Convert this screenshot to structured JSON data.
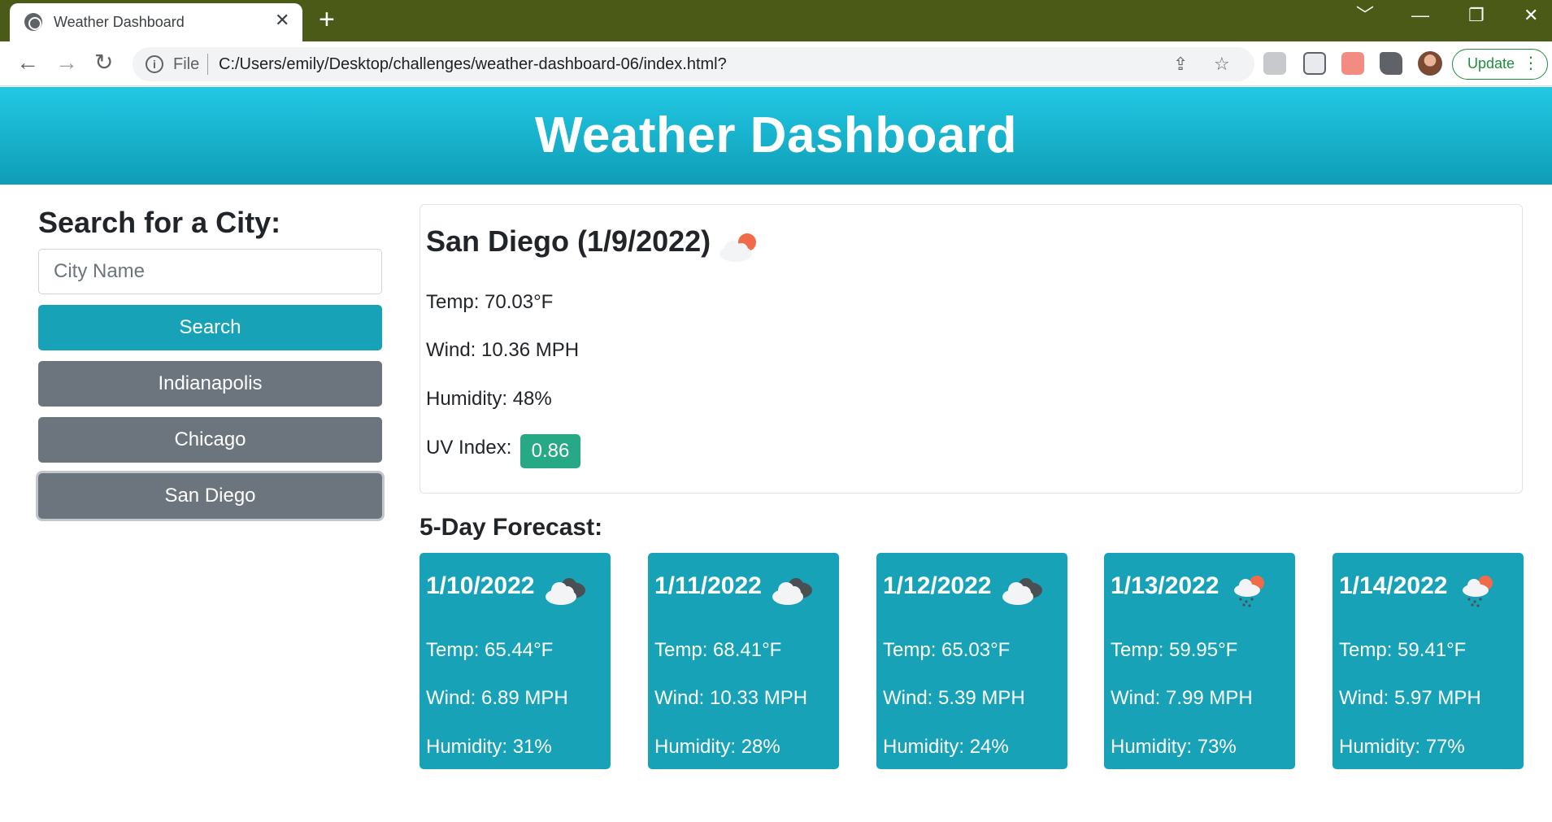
{
  "browser": {
    "tab_title": "Weather Dashboard",
    "tab_close": "✕",
    "new_tab": "+",
    "window_controls": [
      "﹀",
      "—",
      "❐",
      "✕"
    ],
    "nav": {
      "back": "←",
      "forward": "→",
      "reload": "↻"
    },
    "scheme": "File",
    "url": "C:/Users/emily/Desktop/challenges/weather-dashboard-06/index.html?",
    "update_label": "Update",
    "update_menu": "⋮"
  },
  "header": {
    "title": "Weather Dashboard"
  },
  "sidebar": {
    "heading": "Search for a City:",
    "search_placeholder": "City Name",
    "search_value": "",
    "search_button": "Search",
    "history": [
      "Indianapolis",
      "Chicago",
      "San Diego"
    ]
  },
  "current": {
    "title": "San Diego (1/9/2022)",
    "icon": "few-clouds-day-icon",
    "temp": "Temp: 70.03°F",
    "wind": "Wind: 10.36 MPH",
    "humidity": "Humidity: 48%",
    "uv_label": "UV Index:",
    "uv_value": "0.86",
    "uv_color": "#28a985"
  },
  "forecast": {
    "heading": "5-Day Forecast:",
    "days": [
      {
        "date": "1/10/2022",
        "icon": "broken-clouds-icon",
        "temp": "Temp: 65.44°F",
        "wind": "Wind: 6.89 MPH",
        "humidity": "Humidity: 31%"
      },
      {
        "date": "1/11/2022",
        "icon": "broken-clouds-icon",
        "temp": "Temp: 68.41°F",
        "wind": "Wind: 10.33 MPH",
        "humidity": "Humidity: 28%"
      },
      {
        "date": "1/12/2022",
        "icon": "broken-clouds-icon",
        "temp": "Temp: 65.03°F",
        "wind": "Wind: 5.39 MPH",
        "humidity": "Humidity: 24%"
      },
      {
        "date": "1/13/2022",
        "icon": "rain-day-icon",
        "temp": "Temp: 59.95°F",
        "wind": "Wind: 7.99 MPH",
        "humidity": "Humidity: 73%"
      },
      {
        "date": "1/14/2022",
        "icon": "rain-day-icon",
        "temp": "Temp: 59.41°F",
        "wind": "Wind: 5.97 MPH",
        "humidity": "Humidity: 77%"
      }
    ]
  },
  "colors": {
    "header_gradient_top": "#22c8e4",
    "header_gradient_bottom": "#0f9db6",
    "search_button": "#17a2b8",
    "history_button": "#6c757d",
    "forecast_card": "#17a2b8",
    "tab_bar": "#4b5a17"
  }
}
